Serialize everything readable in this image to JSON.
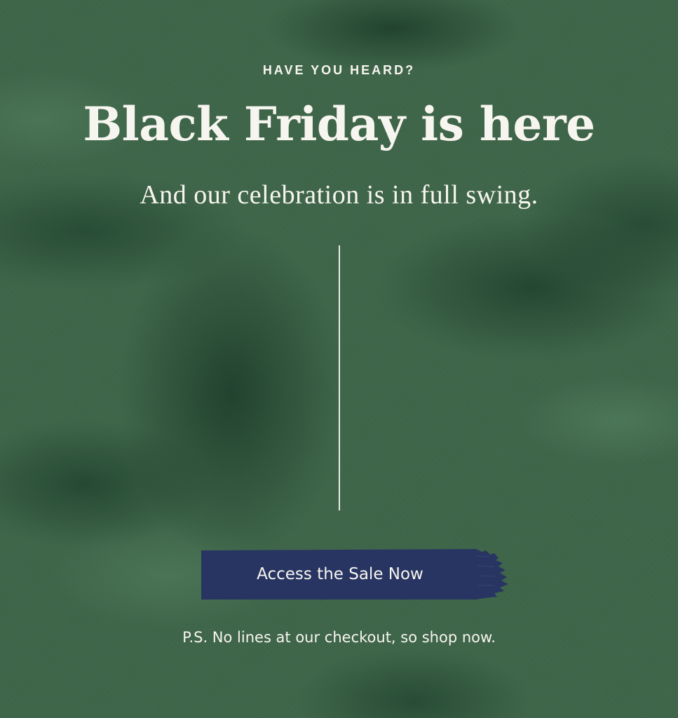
{
  "eyebrow": "HAVE YOU HEARD?",
  "headline": "Black Friday is here",
  "subhead": "And our celebration is in full swing.",
  "cta": {
    "label": "Access the Sale Now",
    "color": "#283562"
  },
  "footnote": "P.S. No lines at our checkout, so shop now.",
  "colors": {
    "background": "#3d6548",
    "text": "#f7f5ef",
    "divider": "#e9ece7"
  }
}
